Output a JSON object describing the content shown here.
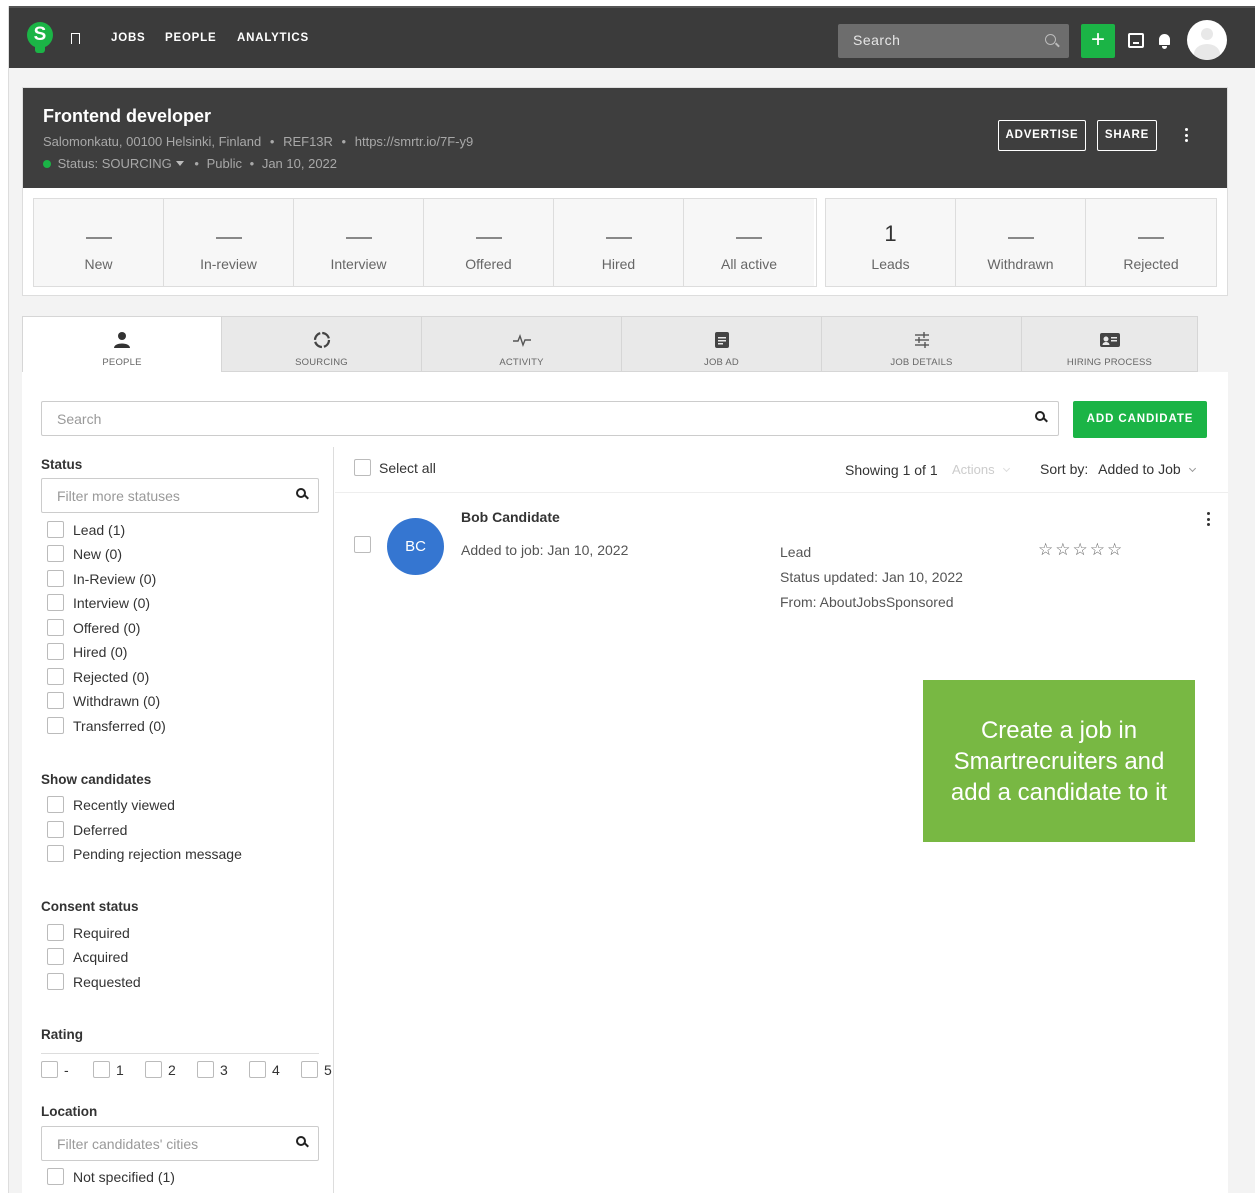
{
  "topbar": {
    "logo_letter": "S",
    "nav": [
      "JOBS",
      "PEOPLE",
      "ANALYTICS"
    ],
    "search_placeholder": "Search",
    "plus_label": "+"
  },
  "job": {
    "title": "Frontend developer",
    "location": "Salomonkatu, 00100 Helsinki, Finland",
    "ref": "REF13R",
    "url": "https://smrtr.io/7F-y9",
    "status_label": "Status:",
    "status_value": "SOURCING",
    "visibility": "Public",
    "date": "Jan 10, 2022",
    "advertise_label": "ADVERTISE",
    "share_label": "SHARE",
    "separator": "•"
  },
  "stats_left": [
    {
      "label": "New",
      "value": ""
    },
    {
      "label": "In-review",
      "value": ""
    },
    {
      "label": "Interview",
      "value": ""
    },
    {
      "label": "Offered",
      "value": ""
    },
    {
      "label": "Hired",
      "value": ""
    },
    {
      "label": "All active",
      "value": ""
    }
  ],
  "stats_right": [
    {
      "label": "Leads",
      "value": "1"
    },
    {
      "label": "Withdrawn",
      "value": ""
    },
    {
      "label": "Rejected",
      "value": ""
    }
  ],
  "tabs": [
    "PEOPLE",
    "SOURCING",
    "ACTIVITY",
    "JOB AD",
    "JOB DETAILS",
    "HIRING PROCESS"
  ],
  "main": {
    "search_placeholder": "Search",
    "add_candidate_label": "ADD CANDIDATE"
  },
  "filters": {
    "status_title": "Status",
    "status_placeholder": "Filter more statuses",
    "statuses": [
      "Lead (1)",
      "New (0)",
      "In-Review (0)",
      "Interview (0)",
      "Offered (0)",
      "Hired (0)",
      "Rejected (0)",
      "Withdrawn (0)",
      "Transferred (0)"
    ],
    "show_title": "Show candidates",
    "show_items": [
      "Recently viewed",
      "Deferred",
      "Pending rejection message"
    ],
    "consent_title": "Consent status",
    "consent_items": [
      "Required",
      "Acquired",
      "Requested"
    ],
    "rating_title": "Rating",
    "rating_items": [
      "-",
      "1",
      "2",
      "3",
      "4",
      "5"
    ],
    "location_title": "Location",
    "location_placeholder": "Filter candidates' cities",
    "location_items": [
      "Not specified (1)"
    ]
  },
  "list": {
    "select_all": "Select all",
    "showing": "Showing 1 of 1",
    "actions": "Actions",
    "sort_by": "Sort by:",
    "sort_value": "Added to Job"
  },
  "candidate": {
    "initials": "BC",
    "name": "Bob Candidate",
    "added": "Added to job: Jan 10, 2022",
    "status": "Lead",
    "status_updated": "Status updated: Jan 10, 2022",
    "source": "From: AboutJobsSponsored",
    "stars": "☆☆☆☆☆"
  },
  "promo": {
    "line1": "Create a job in",
    "line2": "Smartrecruiters and",
    "line3": "add a candidate to it"
  },
  "colors": {
    "brand_green": "#1bb446",
    "topbar": "#3b3b3b",
    "avatar_blue": "#3576d1",
    "promo_green": "#78b843"
  }
}
